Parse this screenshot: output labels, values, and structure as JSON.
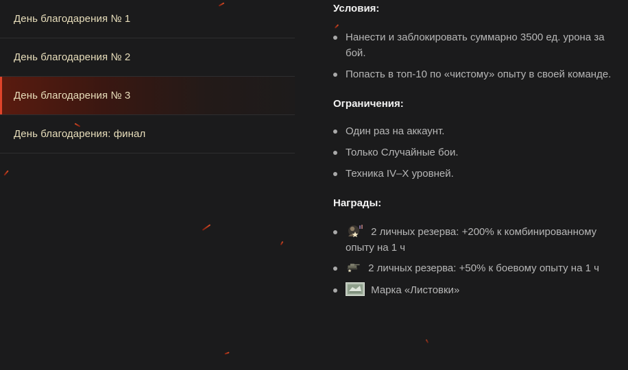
{
  "nav": {
    "items": [
      {
        "label": "День благодарения № 1",
        "active": false
      },
      {
        "label": "День благодарения № 2",
        "active": false
      },
      {
        "label": "День благодарения № 3",
        "active": true
      },
      {
        "label": "День благодарения: финал",
        "active": false
      }
    ]
  },
  "conditions": {
    "title": "Условия:",
    "items": [
      "Нанести и заблокировать суммарно 3500 ед. урона за бой.",
      "Попасть в топ-10 по «чистому» опыту в своей команде."
    ]
  },
  "restrictions": {
    "title": "Ограничения:",
    "items": [
      "Один раз на аккаунт.",
      "Только Случайные бои.",
      "Техника IV–X уровней."
    ]
  },
  "rewards": {
    "title": "Награды:",
    "items": [
      {
        "icon": "crew-xp-reserve-icon",
        "text": "2 личных резерва: +200% к комбинированному опыту на 1 ч"
      },
      {
        "icon": "battle-xp-reserve-icon",
        "text": "2 личных резерва: +50% к боевому опыту на 1 ч"
      },
      {
        "icon": "leaflet-stamp-icon",
        "text": "Марка «Листовки»"
      }
    ]
  },
  "colors": {
    "background": "#1b1b1c",
    "nav_text": "#e9dfbc",
    "active_accent": "#e0442a",
    "body_text": "#b7b7b7",
    "heading_text": "#f2f2f2"
  }
}
